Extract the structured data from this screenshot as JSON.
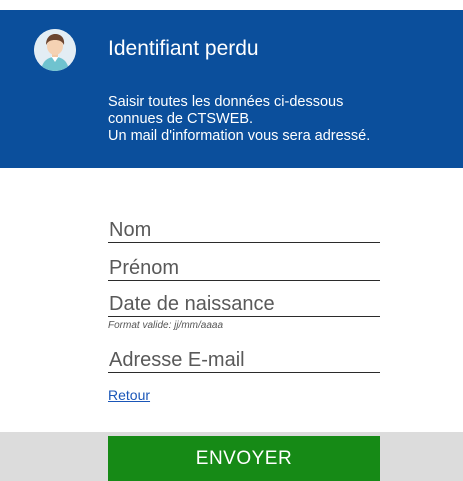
{
  "header": {
    "title": "Identifiant perdu",
    "message_lines": [
      "Saisir toutes les données ci-dessous",
      "connues de CTSWEB.",
      "Un mail d'information vous sera adressé."
    ],
    "avatar_icon": "user-avatar-icon"
  },
  "form": {
    "nom": {
      "placeholder": "Nom",
      "value": ""
    },
    "prenom": {
      "placeholder": "Prénom",
      "value": ""
    },
    "date_naissance": {
      "placeholder": "Date de naissance",
      "value": "",
      "hint": "Format valide: jj/mm/aaaa"
    },
    "email": {
      "placeholder": "Adresse E-mail",
      "value": ""
    },
    "back_link": "Retour",
    "submit_label": "ENVOYER"
  },
  "colors": {
    "header_bg": "#0b4f9c",
    "submit_bg": "#168a16",
    "link": "#1a56b8",
    "footer_band": "#dcdcdc"
  }
}
